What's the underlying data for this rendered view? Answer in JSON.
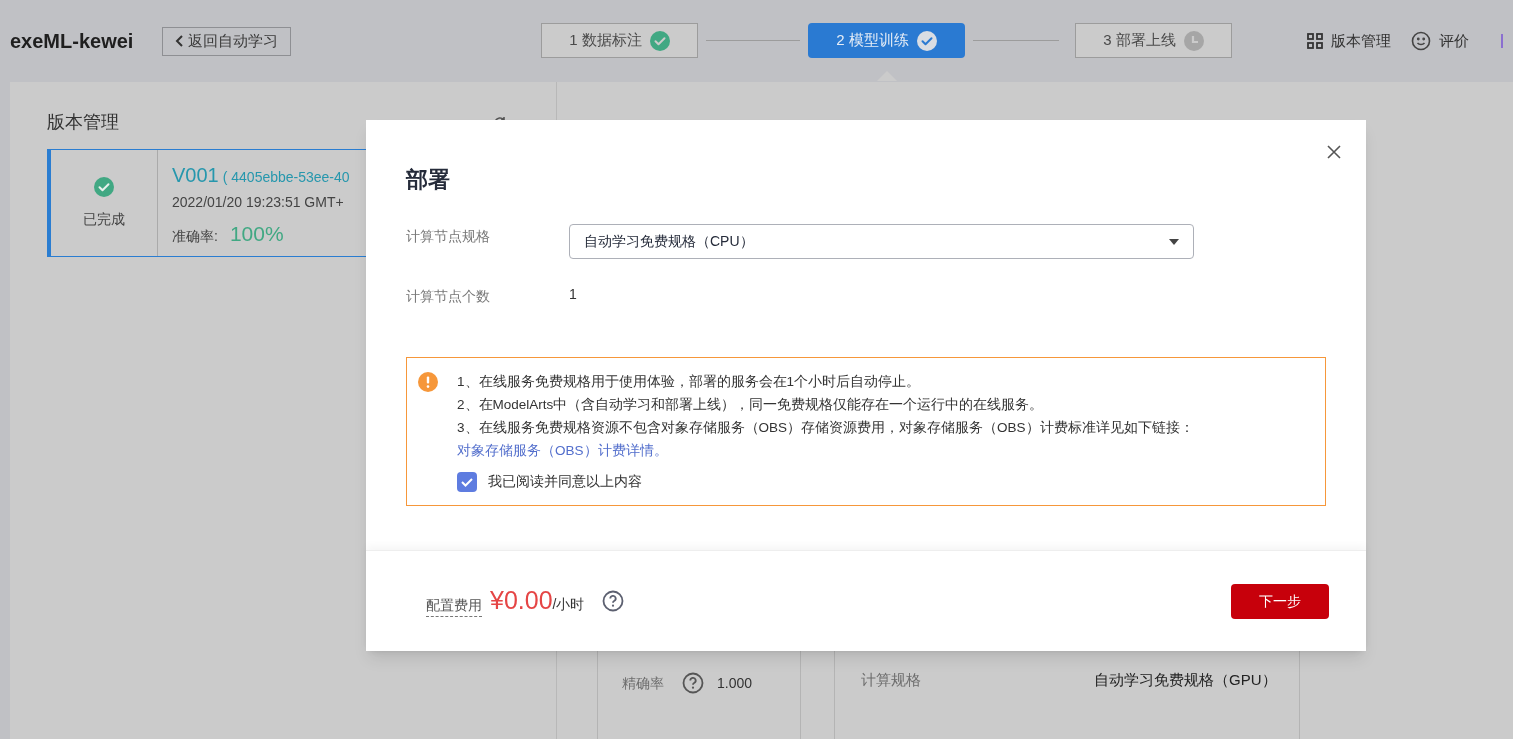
{
  "header": {
    "app_title": "exeML-kewei",
    "back_button": "返回自动学习",
    "steps": [
      {
        "number": "1",
        "label": "数据标注",
        "kind": "done",
        "selected": false
      },
      {
        "number": "2",
        "label": "模型训练",
        "kind": "done",
        "selected": true
      },
      {
        "number": "3",
        "label": "部署上线",
        "kind": "pending",
        "selected": false
      }
    ],
    "actions": [
      {
        "label": "版本管理",
        "kind": "grid"
      },
      {
        "label": "评价",
        "kind": "smile"
      }
    ]
  },
  "version_panel": {
    "title": "版本管理",
    "versions": [
      {
        "status": "已完成",
        "version": "V001",
        "id": "( 4405ebbe-53ee-40",
        "time": "2022/01/20 19:23:51 GMT+",
        "accuracy_label": "准确率:",
        "accuracy": "100%",
        "selected": true
      }
    ]
  },
  "training_details": {
    "metrics": [
      {
        "label": "精确率",
        "value": "1.000"
      }
    ],
    "specs": [
      {
        "label": "计算规格",
        "value": "自动学习免费规格（GPU）"
      }
    ]
  },
  "dialog": {
    "title": "部署",
    "fields": [
      {
        "label": "计算节点规格",
        "kind": "select",
        "value": "自动学习免费规格（CPU）"
      },
      {
        "label": "计算节点个数",
        "kind": "text",
        "value": "1"
      }
    ],
    "notice": {
      "items": [
        "1、在线服务免费规格用于使用体验，部署的服务会在1个小时后自动停止。",
        "2、在ModelArts中（含自动学习和部署上线），同一免费规格仅能存在一个运行中的在线服务。",
        "3、在线服务免费规格资源不包含对象存储服务（OBS）存储资源费用，对象存储服务（OBS）计费标准详见如下链接："
      ],
      "link": "对象存储服务（OBS）计费详情。"
    },
    "agree": {
      "label": "我已阅读并同意以上内容",
      "checked": true
    },
    "fee": {
      "label": "配置费用",
      "amount": "¥0.00",
      "unit": "/小时"
    },
    "next_button": "下一步"
  }
}
